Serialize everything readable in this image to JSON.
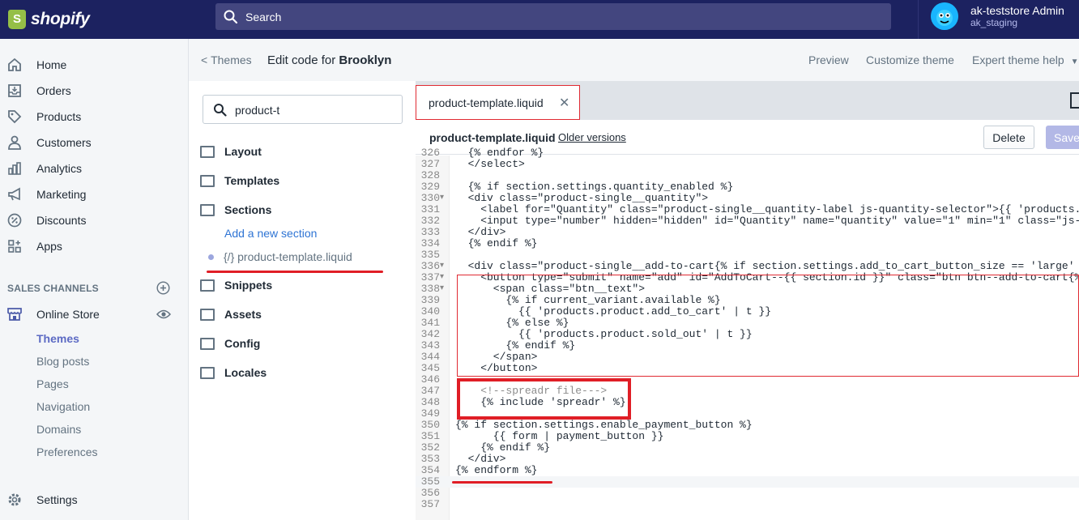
{
  "brand": {
    "name": "shopify"
  },
  "search": {
    "placeholder": "Search"
  },
  "account": {
    "name": "ak-teststore Admin",
    "store": "ak_staging"
  },
  "nav": [
    {
      "label": "Home",
      "icon": "home-icon"
    },
    {
      "label": "Orders",
      "icon": "orders-icon"
    },
    {
      "label": "Products",
      "icon": "tag-icon"
    },
    {
      "label": "Customers",
      "icon": "person-icon"
    },
    {
      "label": "Analytics",
      "icon": "bar-chart-icon"
    },
    {
      "label": "Marketing",
      "icon": "megaphone-icon"
    },
    {
      "label": "Discounts",
      "icon": "discount-icon"
    },
    {
      "label": "Apps",
      "icon": "apps-icon"
    }
  ],
  "sales_channels": {
    "heading": "SALES CHANNELS",
    "online_store": "Online Store",
    "items": [
      "Themes",
      "Blog posts",
      "Pages",
      "Navigation",
      "Domains",
      "Preferences"
    ]
  },
  "settings": "Settings",
  "header": {
    "back": "Themes",
    "title_prefix": "Edit code for",
    "theme": "Brooklyn",
    "preview": "Preview",
    "customize": "Customize theme",
    "help": "Expert theme help"
  },
  "files": {
    "search_value": "product-t",
    "folders": [
      "Layout",
      "Templates",
      "Sections",
      "Snippets",
      "Assets",
      "Config",
      "Locales"
    ],
    "add_section": "Add a new section",
    "current_file": "{/} product-template.liquid"
  },
  "editor": {
    "tab": "product-template.liquid",
    "file": "product-template.liquid",
    "older": "Older versions",
    "delete": "Delete",
    "save": "Save"
  },
  "code": [
    {
      "n": "326",
      "t": "  {% endfor %}"
    },
    {
      "n": "327",
      "t": "  </select>"
    },
    {
      "n": "328",
      "t": ""
    },
    {
      "n": "329",
      "t": "  {% if section.settings.quantity_enabled %}"
    },
    {
      "n": "330",
      "t": "  <div class=\"product-single__quantity\">"
    },
    {
      "n": "331",
      "t": "    <label for=\"Quantity\" class=\"product-single__quantity-label js-quantity-selector\">{{ 'products.p"
    },
    {
      "n": "332",
      "t": "    <input type=\"number\" hidden=\"hidden\" id=\"Quantity\" name=\"quantity\" value=\"1\" min=\"1\" class=\"js-q"
    },
    {
      "n": "333",
      "t": "  </div>"
    },
    {
      "n": "334",
      "t": "  {% endif %}"
    },
    {
      "n": "335",
      "t": ""
    },
    {
      "n": "336",
      "t": "  <div class=\"product-single__add-to-cart{% if section.settings.add_to_cart_button_size == 'large' %"
    },
    {
      "n": "337",
      "t": "    <button type=\"submit\" name=\"add\" id=\"AddToCart--{{ section.id }}\" class=\"btn btn--add-to-cart{%"
    },
    {
      "n": "338",
      "t": "      <span class=\"btn__text\">"
    },
    {
      "n": "339",
      "t": "        {% if current_variant.available %}"
    },
    {
      "n": "340",
      "t": "          {{ 'products.product.add_to_cart' | t }}"
    },
    {
      "n": "341",
      "t": "        {% else %}"
    },
    {
      "n": "342",
      "t": "          {{ 'products.product.sold_out' | t }}"
    },
    {
      "n": "343",
      "t": "        {% endif %}"
    },
    {
      "n": "344",
      "t": "      </span>"
    },
    {
      "n": "345",
      "t": "    </button>"
    },
    {
      "n": "346",
      "t": ""
    },
    {
      "n": "347",
      "t": "    <!--spreadr file--->"
    },
    {
      "n": "348",
      "t": "    {% include 'spreadr' %}"
    },
    {
      "n": "349",
      "t": ""
    },
    {
      "n": "350",
      "t": "{% if section.settings.enable_payment_button %}"
    },
    {
      "n": "351",
      "t": "      {{ form | payment_button }}"
    },
    {
      "n": "352",
      "t": "    {% endif %}"
    },
    {
      "n": "353",
      "t": "  </div>"
    },
    {
      "n": "354",
      "t": "{% endform %}"
    },
    {
      "n": "355",
      "t": ""
    },
    {
      "n": "356",
      "t": ""
    },
    {
      "n": "357",
      "t": ""
    }
  ]
}
